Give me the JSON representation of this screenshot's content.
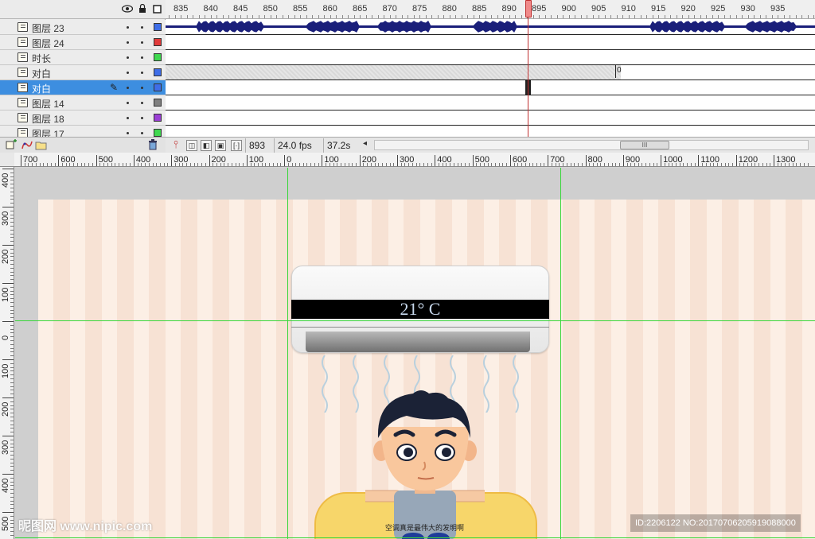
{
  "timeline": {
    "header_icons": [
      "eye-icon",
      "lock-icon",
      "outline-icon"
    ],
    "frame_numbers": [
      "835",
      "840",
      "845",
      "850",
      "855",
      "860",
      "865",
      "870",
      "875",
      "880",
      "885",
      "890",
      "895",
      "900",
      "905",
      "910",
      "915",
      "920",
      "925",
      "930",
      "935"
    ],
    "layers": [
      {
        "name": "图层 23",
        "color": "#3f6ee8"
      },
      {
        "name": "图层 24",
        "color": "#e23b3b"
      },
      {
        "name": "时长",
        "color": "#3fd84f"
      },
      {
        "name": "对白",
        "color": "#3f6ee8"
      },
      {
        "name": "对白",
        "color": "#3f6ee8"
      },
      {
        "name": "图层 14",
        "color": "#808080"
      },
      {
        "name": "图层 18",
        "color": "#9b3fd6"
      },
      {
        "name": "图层 17",
        "color": "#3fd84f"
      }
    ],
    "frame_label": "0",
    "status": {
      "frame": "893",
      "fps": "24.0 fps",
      "time": "37.2s"
    },
    "scroll_thumb": "III"
  },
  "rulers": {
    "top_labels": [
      "700",
      "600",
      "500",
      "400",
      "300",
      "200",
      "100",
      "0",
      "100",
      "200",
      "300",
      "400",
      "500",
      "600",
      "700",
      "800",
      "900",
      "1000",
      "1100",
      "1200",
      "1300"
    ],
    "left_labels": [
      "400",
      "300",
      "200",
      "100",
      "0",
      "100",
      "200",
      "300",
      "400",
      "500"
    ]
  },
  "stage": {
    "ac_temperature": "21° C",
    "caption": "空调真是最伟大的发明啊",
    "watermark_left": "昵图网 www.nipic.com",
    "watermark_right": "ID:2206122 NO:20170706205919088000"
  }
}
